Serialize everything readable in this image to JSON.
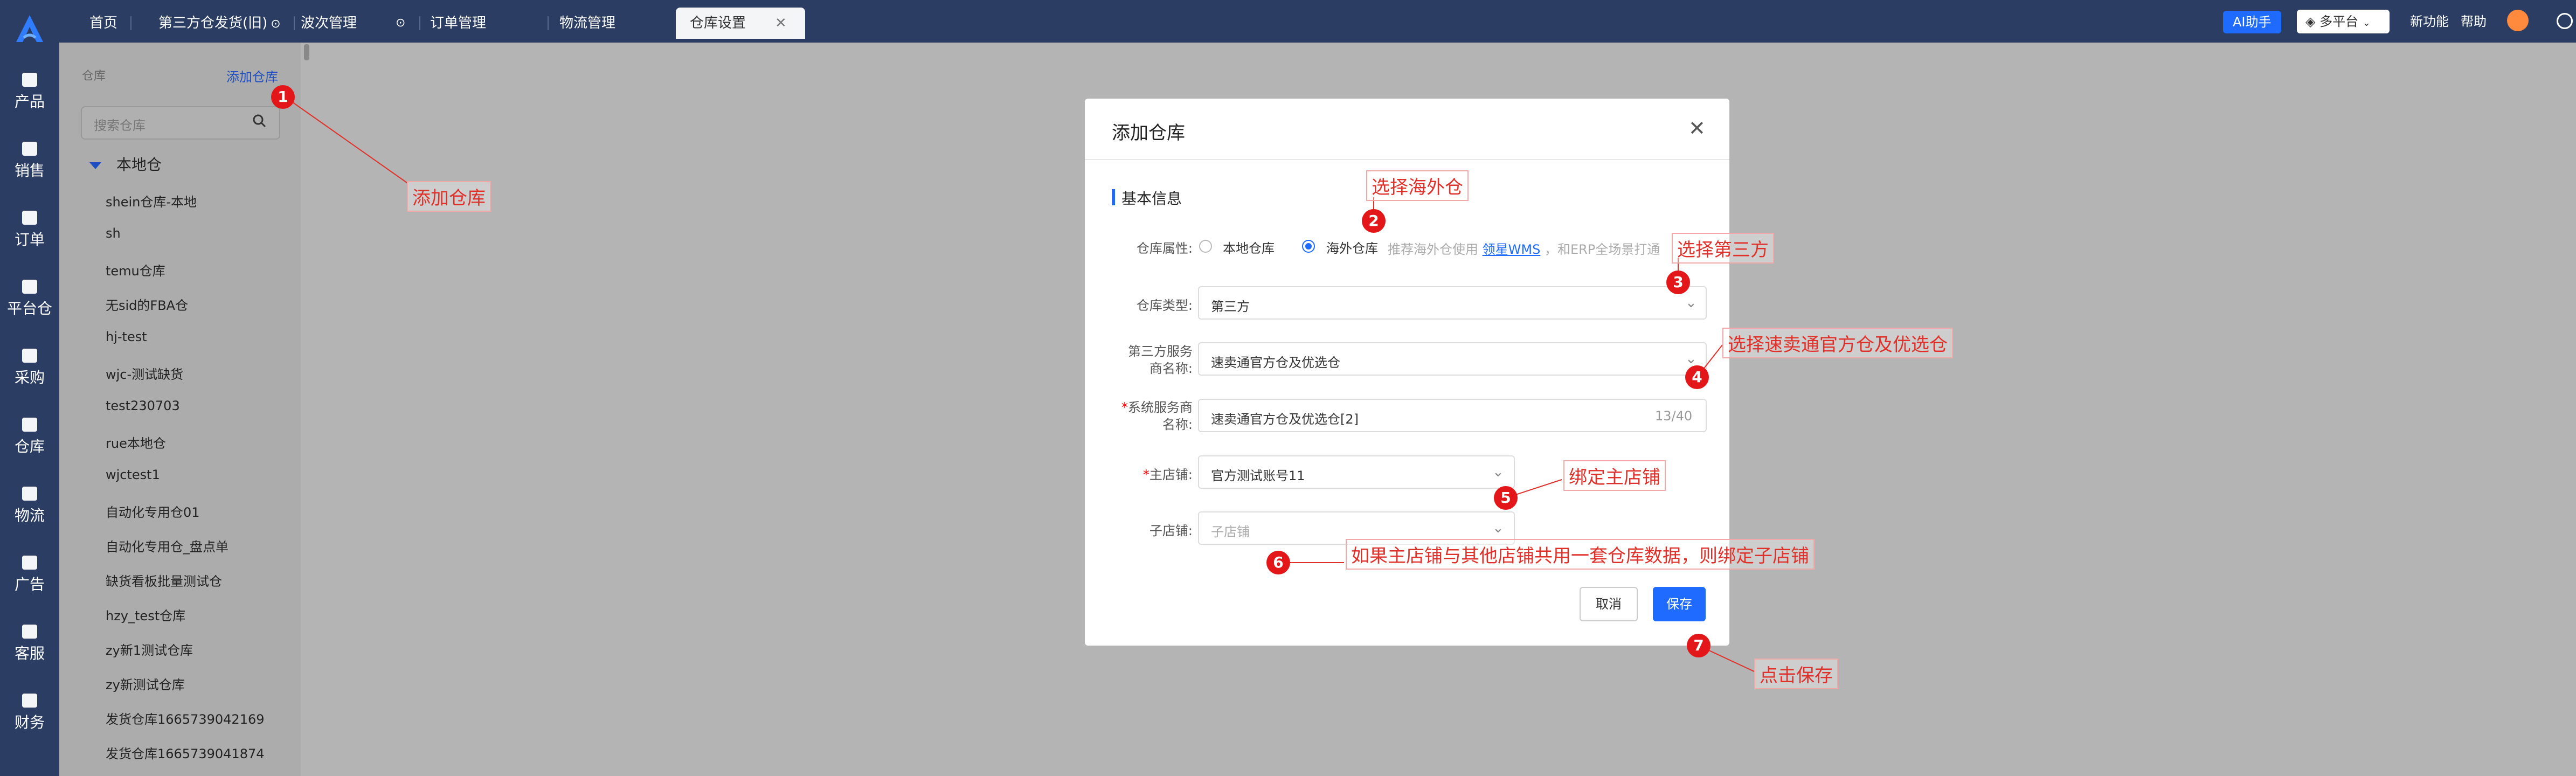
{
  "topbar": {
    "tabs": [
      "首页",
      "第三方仓发货(旧)",
      "波次管理",
      "订单管理",
      "物流管理",
      "仓库设置"
    ],
    "ai_label": "AI助手",
    "platform_label": "多平台",
    "new_features": "新功能",
    "help": "帮助"
  },
  "leftnav": [
    "产品",
    "销售",
    "订单",
    "平台仓",
    "采购",
    "仓库",
    "物流",
    "广告",
    "客服",
    "财务"
  ],
  "sidepanel": {
    "title": "仓库",
    "add_label": "添加仓库",
    "search_placeholder": "搜索仓库",
    "group": "本地仓",
    "items": [
      "shein仓库-本地",
      "sh",
      "temu仓库",
      "无sid的FBA仓",
      "hj-test",
      "wjc-测试缺货",
      "test230703",
      "rue本地仓",
      "wjctest1",
      "自动化专用仓01",
      "自动化专用仓_盘点单",
      "缺货看板批量测试仓",
      "hzy_test仓库",
      "zy新1测试仓库",
      "zy新测试仓库",
      "发货仓库1665739042169",
      "发货仓库1665739041874"
    ]
  },
  "modal": {
    "title": "添加仓库",
    "section": "基本信息",
    "attr_label": "仓库属性:",
    "local_option": "本地仓库",
    "overseas_option": "海外仓库",
    "hint_prefix": "推荐海外仓使用",
    "hint_link": "领星WMS",
    "hint_suffix": "，和ERP全场景打通",
    "type_label": "仓库类型:",
    "type_value": "第三方",
    "provider_label_1": "第三方服务",
    "provider_label_2": "商名称:",
    "provider_value": "速卖通官方仓及优选仓",
    "sys_label_1": "系统服务商",
    "sys_label_2": "名称:",
    "sys_value": "速卖通官方仓及优选仓[2]",
    "sys_count": "13/40",
    "main_store_label": "主店铺:",
    "main_store_value": "官方测试账号11",
    "sub_store_label": "子店铺:",
    "sub_store_placeholder": "子店铺",
    "cancel": "取消",
    "save": "保存"
  },
  "annotations": {
    "a1": "添加仓库",
    "a2": "选择海外仓",
    "a3": "选择第三方",
    "a4": "选择速卖通官方仓及优选仓",
    "a5": "绑定主店铺",
    "a6": "如果主店铺与其他店铺共用一套仓库数据，则绑定子店铺",
    "a7": "点击保存",
    "badges": [
      "1",
      "2",
      "3",
      "4",
      "5",
      "6",
      "7"
    ]
  }
}
